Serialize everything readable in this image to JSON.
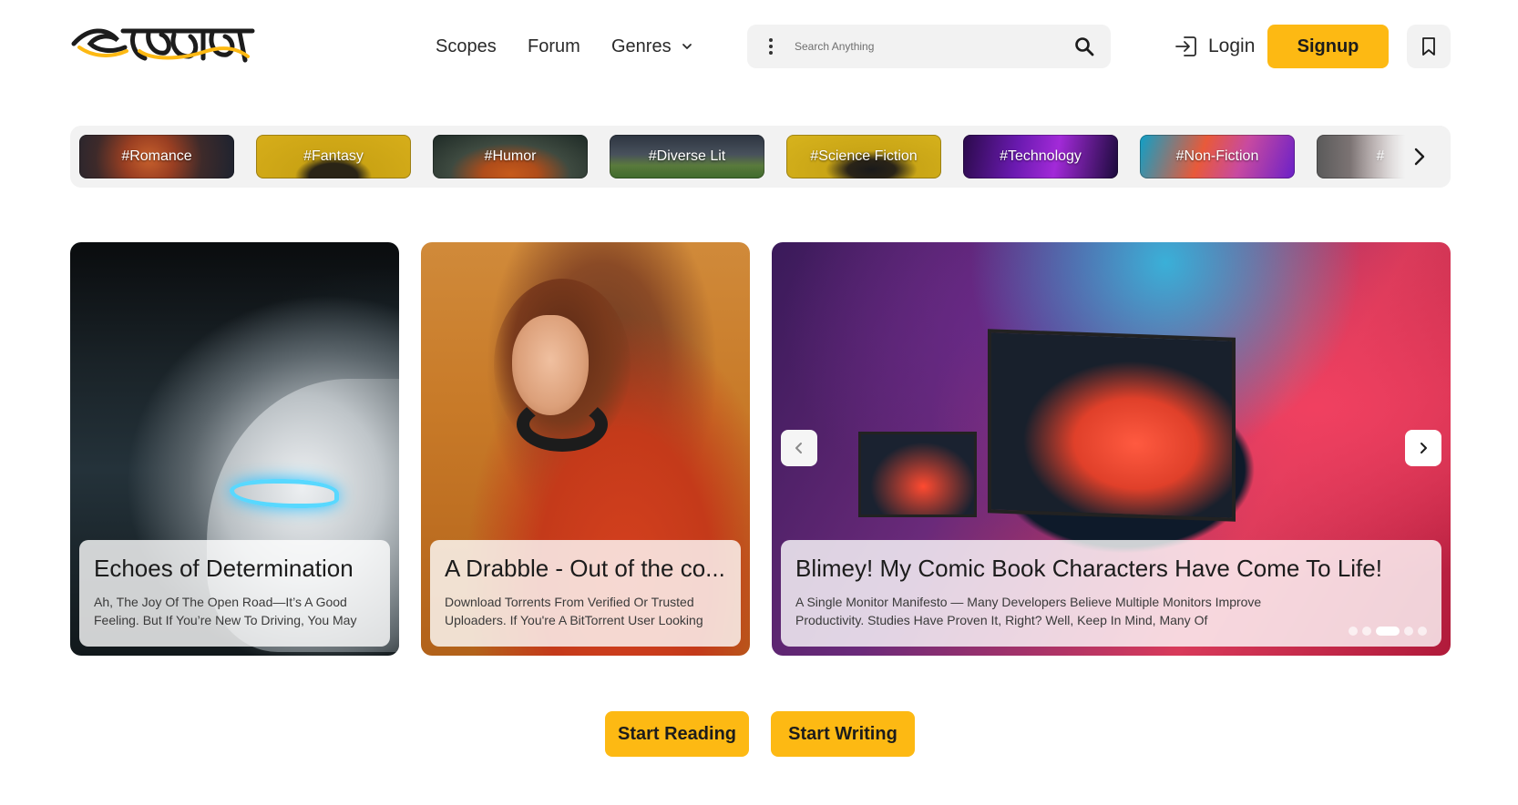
{
  "brand": {
    "logo_text": "গল্পকথা",
    "accent_color": "#fdb913"
  },
  "nav": {
    "scopes": "Scopes",
    "forum": "Forum",
    "genres": "Genres"
  },
  "search": {
    "placeholder": "Search Anything"
  },
  "auth": {
    "login": "Login",
    "signup": "Signup"
  },
  "genres": [
    {
      "label": "#Romance"
    },
    {
      "label": "#Fantasy"
    },
    {
      "label": "#Humor"
    },
    {
      "label": "#Diverse Lit"
    },
    {
      "label": "#Science Fiction"
    },
    {
      "label": "#Technology"
    },
    {
      "label": "#Non-Fiction"
    },
    {
      "label": "#"
    }
  ],
  "cards": [
    {
      "title": "Echoes of Determination",
      "excerpt": "Ah, The Joy Of The Open Road—It’s A Good Feeling. But If You’re New To Driving, You May"
    },
    {
      "title": "A Drabble - Out of the co...",
      "excerpt": "Download Torrents From Verified Or Trusted Uploaders. If You're A BitTorrent User Looking"
    },
    {
      "title": "Blimey! My Comic Book Characters Have Come To Life!",
      "excerpt": "A Single Monitor Manifesto — Many Developers Believe Multiple Monitors Improve Productivity. Studies Have Proven It, Right? Well, Keep In Mind, Many Of"
    }
  ],
  "carousel": {
    "slide_count": 5,
    "active_index": 2
  },
  "cta": {
    "start_reading": "Start Reading",
    "start_writing": "Start Writing"
  }
}
